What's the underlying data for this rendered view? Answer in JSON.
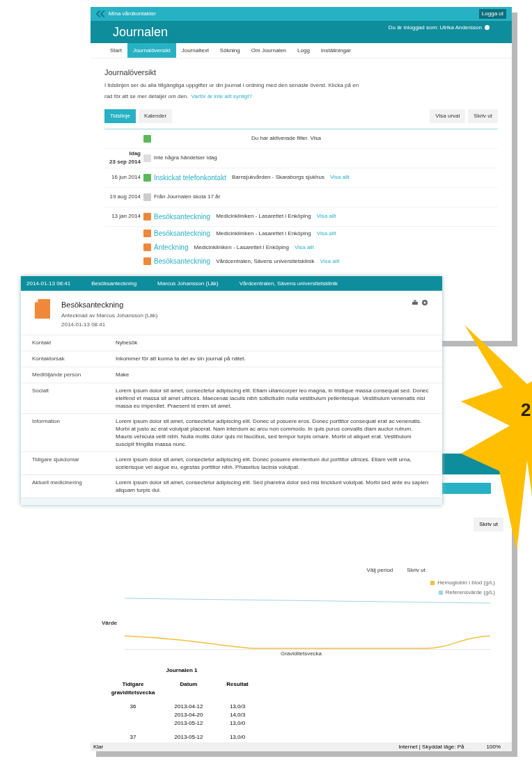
{
  "back_window": {
    "brand": "Mina vårdkontakter",
    "logout": "Logga ut",
    "title": "Journalen",
    "user": "Du är inloggad som: Ulrika Andersson",
    "tabs": [
      {
        "label": "Start",
        "selected": false
      },
      {
        "label": "Journalöversikt",
        "selected": true
      },
      {
        "label": "Journaltext",
        "selected": false
      },
      {
        "label": "Sökning",
        "selected": false
      },
      {
        "label": "Om Journalen",
        "selected": false
      },
      {
        "label": "Logg",
        "selected": false
      },
      {
        "label": "Inställningar",
        "selected": false
      }
    ],
    "heading": "Journalöversikt",
    "intro": "I tidslinjen ser du alla tillgängliga uppgifter ur din journal i ordning med den senaste överst. Klicka på en",
    "intro2": "rad för att se mer detaljer om den.",
    "intro_link": "Varför är inte allt synligt?",
    "views": [
      {
        "label": "Tidslinje",
        "selected": true
      },
      {
        "label": "Kalender",
        "selected": false
      }
    ],
    "actions": [
      "Visa urval",
      "Skriv ut"
    ],
    "filter": "Du har aktiverade filter. Visa",
    "timeline": [
      {
        "color": "#5cb85c"
      },
      {
        "date": "Idag",
        "date2": "23 sep 2014",
        "color": "#dddddd",
        "detail": "Inte några händelser idag"
      },
      {
        "date": "16 jun 2014",
        "color": "#5cb85c",
        "title": "Inskickat telefonkontakt",
        "detail": "Barnsjukvården - Skaraborgs sjukhus",
        "link": "Visa allt"
      },
      {
        "date": "19 aug 2014",
        "color": "#cccccc",
        "detail": "Från Journalen skola 17 år"
      },
      {
        "date": "13 jan 2014",
        "color": "#f0883a",
        "title": "Besöksanteckning",
        "detail": "Medicinkliniken - Lasarettet i Enköping",
        "link": "Visa allt"
      },
      {
        "color": "#f0883a",
        "title": "Besöksanteckning",
        "detail": "Medicinkliniken - Lasarettet i Enköping",
        "link": "Visa allt"
      },
      {
        "color": "#f0883a",
        "title": "Anteckning",
        "detail": "Medicinkliniken - Lasarettet i Enköping",
        "link": "Visa allt"
      },
      {
        "color": "#f0883a",
        "title": "Besöksanteckning",
        "detail": "Vårdcentralen, Sävens universitetsklinik",
        "link": "Visa allt"
      }
    ]
  },
  "lower_window": {
    "period_actions": [
      "Välj period",
      "Skriv ut"
    ],
    "tools": [
      "Skriv ut"
    ],
    "legend": [
      {
        "label": "Hemoglobin i blod (g/L)",
        "color": "#f0c040"
      },
      {
        "label": "Referensvärde (g/L)",
        "color": "#9fd4e8"
      }
    ],
    "ylabel": "Värde",
    "xlabel": "Graviditetsvecka",
    "table": {
      "caption": "Journalen 1",
      "columns": [
        "Tidigare graviditetsvecka",
        "Datum",
        "Resultat"
      ],
      "rows": [
        {
          "cells": [
            "36",
            "2013-04-12\n2013-04-20\n2013-05-12",
            "13,0/3\n14,0/3\n13,0/0"
          ]
        },
        {
          "cells": [
            "37",
            "2013-05-12",
            "13,0/0"
          ]
        }
      ]
    },
    "status": {
      "left": "Klar",
      "zone": "Internet | Skyddat läge: På",
      "zoom": "100%"
    }
  },
  "card": {
    "header": [
      "2014-01-13 08:41",
      "Besöksanteckning",
      "Marcus Johansson (Läk)",
      "Vårdcentralen, Sävens universitetsklinik"
    ],
    "title": "Besöksanteckning",
    "author": "Antecknad av Marcus Johansson (Läk)",
    "time": "2014-01-13 08:41",
    "rows": [
      {
        "label": "Kontakt",
        "value": "Nybesök"
      },
      {
        "label": "Kontaktorsak",
        "value": "Inkommer för att kunna ta del av sin journal på nätet."
      },
      {
        "label": "Medföljande person",
        "value": "Make"
      },
      {
        "label": "Socialt",
        "value": "Lorem ipsum dolor sit amet, consectetur adipiscing elit. Etiam ullamcorper leo magna, in tristique massa consequat sed. Donec eleifend et massa sit amet ultrices. Maecenas iaculis nibh sollicitudin nulla vestibulum pellentesque. Vestibulum venenatis nisi massa eu imperdiet. Praesent id enim sit amet."
      },
      {
        "label": "Information",
        "value": "Lorem ipsum dolor sit amet, consectetur adipiscing elit. Donec ut posuere eros. Donec porttitor consequat erat ac venenatis. Morbi at justo ac erat volutpat placerat. Nam interdum ac arcu non commodo. In quis purus convallis diam auctor rutrum. Mauris vehicula velit nibh. Nulla mollis dolor quis mi faucibus, sed tempor turpis ornare. Morbi ut aliquet erat. Vestibulum suscipit fringilla massa nunc."
      },
      {
        "label": "Tidigare sjukdomar",
        "value": "Lorem ipsum dolor sit amet, consectetur adipiscing elit. Donec posuere elementum dui porttitor ultrices. Etiam velit urna, scelerisque vel augue eu, egestas porttitor nibh. Phasellus lacinia volutpat."
      },
      {
        "label": "Aktuell medicinering",
        "value": "Lorem ipsum dolor sit amet, consectetur adipiscing elit. Sed pharetra dolor sed nisi tincidunt volutpat. Morbi sed ante eu sapien aliquam turpis dui."
      }
    ]
  },
  "badge": "2"
}
